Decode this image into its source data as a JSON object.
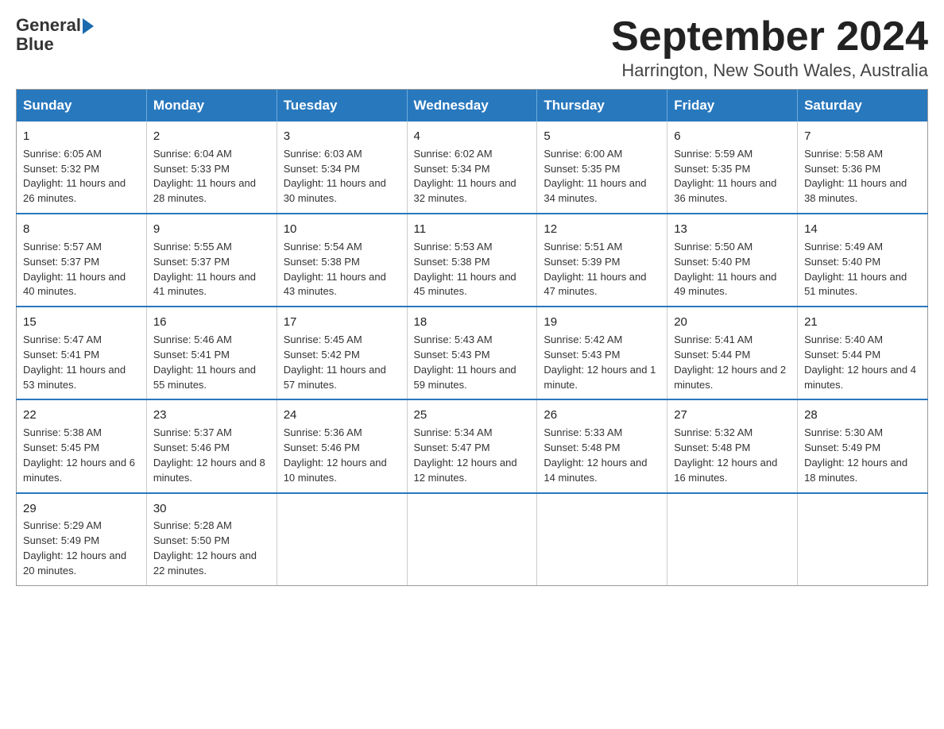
{
  "header": {
    "logo_general": "General",
    "logo_blue": "Blue",
    "month_title": "September 2024",
    "location": "Harrington, New South Wales, Australia"
  },
  "weekdays": [
    "Sunday",
    "Monday",
    "Tuesday",
    "Wednesday",
    "Thursday",
    "Friday",
    "Saturday"
  ],
  "weeks": [
    [
      {
        "day": "1",
        "sunrise": "6:05 AM",
        "sunset": "5:32 PM",
        "daylight": "11 hours and 26 minutes."
      },
      {
        "day": "2",
        "sunrise": "6:04 AM",
        "sunset": "5:33 PM",
        "daylight": "11 hours and 28 minutes."
      },
      {
        "day": "3",
        "sunrise": "6:03 AM",
        "sunset": "5:34 PM",
        "daylight": "11 hours and 30 minutes."
      },
      {
        "day": "4",
        "sunrise": "6:02 AM",
        "sunset": "5:34 PM",
        "daylight": "11 hours and 32 minutes."
      },
      {
        "day": "5",
        "sunrise": "6:00 AM",
        "sunset": "5:35 PM",
        "daylight": "11 hours and 34 minutes."
      },
      {
        "day": "6",
        "sunrise": "5:59 AM",
        "sunset": "5:35 PM",
        "daylight": "11 hours and 36 minutes."
      },
      {
        "day": "7",
        "sunrise": "5:58 AM",
        "sunset": "5:36 PM",
        "daylight": "11 hours and 38 minutes."
      }
    ],
    [
      {
        "day": "8",
        "sunrise": "5:57 AM",
        "sunset": "5:37 PM",
        "daylight": "11 hours and 40 minutes."
      },
      {
        "day": "9",
        "sunrise": "5:55 AM",
        "sunset": "5:37 PM",
        "daylight": "11 hours and 41 minutes."
      },
      {
        "day": "10",
        "sunrise": "5:54 AM",
        "sunset": "5:38 PM",
        "daylight": "11 hours and 43 minutes."
      },
      {
        "day": "11",
        "sunrise": "5:53 AM",
        "sunset": "5:38 PM",
        "daylight": "11 hours and 45 minutes."
      },
      {
        "day": "12",
        "sunrise": "5:51 AM",
        "sunset": "5:39 PM",
        "daylight": "11 hours and 47 minutes."
      },
      {
        "day": "13",
        "sunrise": "5:50 AM",
        "sunset": "5:40 PM",
        "daylight": "11 hours and 49 minutes."
      },
      {
        "day": "14",
        "sunrise": "5:49 AM",
        "sunset": "5:40 PM",
        "daylight": "11 hours and 51 minutes."
      }
    ],
    [
      {
        "day": "15",
        "sunrise": "5:47 AM",
        "sunset": "5:41 PM",
        "daylight": "11 hours and 53 minutes."
      },
      {
        "day": "16",
        "sunrise": "5:46 AM",
        "sunset": "5:41 PM",
        "daylight": "11 hours and 55 minutes."
      },
      {
        "day": "17",
        "sunrise": "5:45 AM",
        "sunset": "5:42 PM",
        "daylight": "11 hours and 57 minutes."
      },
      {
        "day": "18",
        "sunrise": "5:43 AM",
        "sunset": "5:43 PM",
        "daylight": "11 hours and 59 minutes."
      },
      {
        "day": "19",
        "sunrise": "5:42 AM",
        "sunset": "5:43 PM",
        "daylight": "12 hours and 1 minute."
      },
      {
        "day": "20",
        "sunrise": "5:41 AM",
        "sunset": "5:44 PM",
        "daylight": "12 hours and 2 minutes."
      },
      {
        "day": "21",
        "sunrise": "5:40 AM",
        "sunset": "5:44 PM",
        "daylight": "12 hours and 4 minutes."
      }
    ],
    [
      {
        "day": "22",
        "sunrise": "5:38 AM",
        "sunset": "5:45 PM",
        "daylight": "12 hours and 6 minutes."
      },
      {
        "day": "23",
        "sunrise": "5:37 AM",
        "sunset": "5:46 PM",
        "daylight": "12 hours and 8 minutes."
      },
      {
        "day": "24",
        "sunrise": "5:36 AM",
        "sunset": "5:46 PM",
        "daylight": "12 hours and 10 minutes."
      },
      {
        "day": "25",
        "sunrise": "5:34 AM",
        "sunset": "5:47 PM",
        "daylight": "12 hours and 12 minutes."
      },
      {
        "day": "26",
        "sunrise": "5:33 AM",
        "sunset": "5:48 PM",
        "daylight": "12 hours and 14 minutes."
      },
      {
        "day": "27",
        "sunrise": "5:32 AM",
        "sunset": "5:48 PM",
        "daylight": "12 hours and 16 minutes."
      },
      {
        "day": "28",
        "sunrise": "5:30 AM",
        "sunset": "5:49 PM",
        "daylight": "12 hours and 18 minutes."
      }
    ],
    [
      {
        "day": "29",
        "sunrise": "5:29 AM",
        "sunset": "5:49 PM",
        "daylight": "12 hours and 20 minutes."
      },
      {
        "day": "30",
        "sunrise": "5:28 AM",
        "sunset": "5:50 PM",
        "daylight": "12 hours and 22 minutes."
      },
      null,
      null,
      null,
      null,
      null
    ]
  ],
  "labels": {
    "sunrise": "Sunrise:",
    "sunset": "Sunset:",
    "daylight": "Daylight:"
  }
}
